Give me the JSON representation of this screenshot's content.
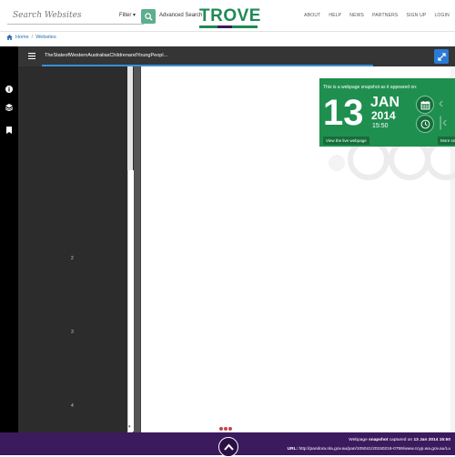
{
  "header": {
    "search_placeholder": "Search Websites",
    "filter_label": "Filter",
    "advanced_search_label": "Advanced Search",
    "logo_text": "TROVE",
    "nav": [
      "ABOUT",
      "HELP",
      "NEWS",
      "PARTNERS",
      "SIGN UP",
      "LOGIN"
    ],
    "colors": {
      "logo_green": "#1e8a56",
      "search_button": "#5cae8d"
    }
  },
  "breadcrumb": {
    "home": "Home",
    "separator": "/",
    "current": "Websites"
  },
  "viewer": {
    "title": "TheStateofWesternAustraliasChildrenandYoungPeopl...",
    "thumbnail_page_numbers": [
      "2",
      "3",
      "4"
    ],
    "rail_icons": [
      "info-icon",
      "layers-icon",
      "bookmark-icon"
    ]
  },
  "wayback": {
    "heading": "This is a webpage snapshot as it appeared on:",
    "day": "13",
    "month": "JAN",
    "year": "2014",
    "time": "15:50",
    "view_live": "View the live webpage",
    "more": "More sn",
    "colors": {
      "card": "#1f8f4f",
      "dark": "#156e3b"
    }
  },
  "footer": {
    "snapshot_prefix": "Webpage",
    "snapshot_bold": "snapshot",
    "snapshot_mid": "captured on",
    "snapshot_date": "13 Jan 2014 15:50",
    "url_label": "URL:",
    "url_value": "http://pandora.nla.gov.au/pan/105041/20150216-0759/www.ccyp.wa.gov.au/Lu",
    "colors": {
      "bar": "#3b1a5e"
    }
  }
}
